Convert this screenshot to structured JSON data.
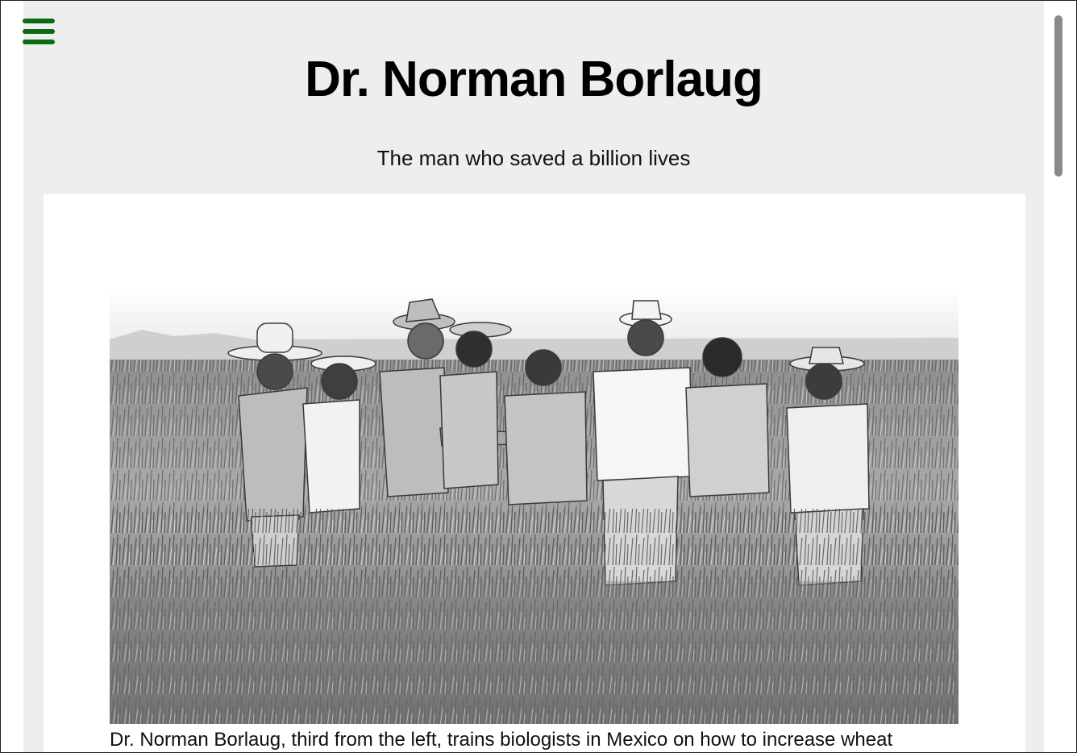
{
  "nav": {
    "menu_icon": "hamburger-menu-icon",
    "menu_color": "#0b6b14"
  },
  "header": {
    "title": "Dr. Norman Borlaug",
    "subtitle": "The man who saved a billion lives"
  },
  "figure": {
    "image_alt": "Black-and-white photograph of eight men in hats standing in a wheat field examining wheat stalks",
    "caption": "Dr. Norman Borlaug, third from the left, trains biologists in Mexico on how to increase wheat"
  },
  "colors": {
    "page_background": "#eeeeee",
    "card_background": "#ffffff",
    "text": "#000000"
  }
}
